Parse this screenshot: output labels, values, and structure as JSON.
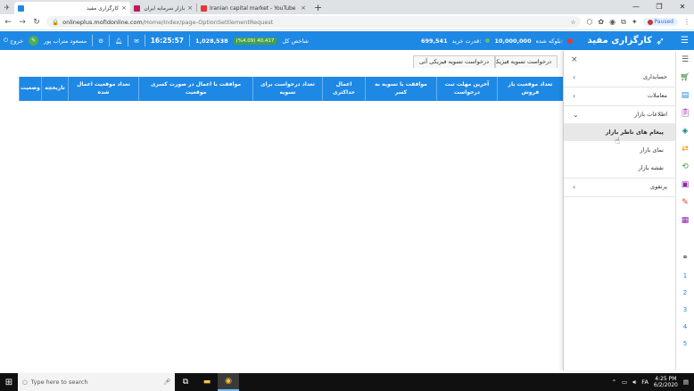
{
  "browser": {
    "tabs": [
      {
        "title": "کارگزاری مفید",
        "active": true,
        "favicon_color": "#1e88e5"
      },
      {
        "title": "بازار سرمایه ایران",
        "active": false,
        "favicon_color": "#c2185b"
      },
      {
        "title": "Iranian capital market - YouTube",
        "active": false,
        "favicon_color": "#e53935"
      }
    ],
    "new_tab": "+",
    "url_host": "onlineplus.mofidonline.com",
    "url_path": "/Home/Index/page-OptionSettlementRequest",
    "paused_label": "Paused"
  },
  "header": {
    "exit_label": "خروج",
    "user_name": "مسعود متراب پور",
    "time": "16:25:57",
    "index_value": "1,028,538",
    "index_change": "(%4.09) 40,417",
    "index_label": "شاخص کل",
    "buying_power_label": "قدرت خرید:",
    "buying_power_value": "699,541",
    "blocked_label": "بلوکه شده:",
    "blocked_value": "10,000,000",
    "brand": "کارگزاری مفید"
  },
  "subtabs": [
    {
      "label": "درخواست تسویه فیزیکی آتی"
    },
    {
      "label": "درخواست تسویه فیزیکی اختیار"
    }
  ],
  "table": {
    "columns": [
      "تعداد موقعیت باز فروش",
      "آخرین مهلت ثبت درخواست",
      "موافقت با تسویه به کسر",
      "اعمال حداکثری",
      "تعداد درخواست برای تسویه",
      "موافقت با اعمال در صورت کسری موقعیت",
      "تعداد موقعیت اعمال شده",
      "تاریخچه",
      "وضعیت"
    ]
  },
  "panel": {
    "close": "×",
    "items": [
      {
        "label": "حسابداری",
        "chevron": "‹"
      },
      {
        "label": "معاملات",
        "chevron": "‹"
      },
      {
        "label": "اطلاعات بازار",
        "chevron": "⌄"
      },
      {
        "label": "پیغام های ناظر بازار"
      },
      {
        "label": "نمای بازار"
      },
      {
        "label": "نقشه بازار"
      },
      {
        "label": "پرتفوی",
        "chevron": "‹"
      }
    ]
  },
  "rail": {
    "numbers": [
      "1",
      "2",
      "3",
      "4",
      "5"
    ]
  },
  "taskbar": {
    "search_placeholder": "Type here to search",
    "lang": "FA",
    "time": "4:25 PM",
    "date": "6/2/2020"
  }
}
